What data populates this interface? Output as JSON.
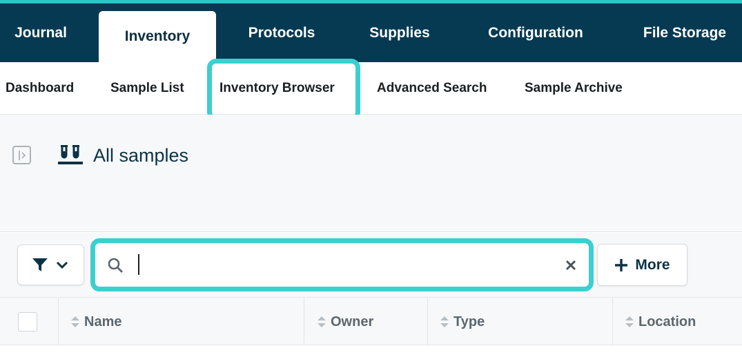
{
  "top_nav": {
    "tabs": [
      {
        "label": "Journal"
      },
      {
        "label": "Inventory",
        "active": true
      },
      {
        "label": "Protocols"
      },
      {
        "label": "Supplies"
      },
      {
        "label": "Configuration"
      },
      {
        "label": "File Storage"
      }
    ]
  },
  "sub_nav": {
    "items": [
      {
        "label": "Dashboard"
      },
      {
        "label": "Sample List"
      },
      {
        "label": "Inventory Browser",
        "highlighted": true
      },
      {
        "label": "Advanced Search"
      },
      {
        "label": "Sample Archive"
      }
    ]
  },
  "page": {
    "title": "All samples"
  },
  "toolbar": {
    "search_value": "",
    "more_label": "More"
  },
  "table": {
    "columns": [
      {
        "label": "Name"
      },
      {
        "label": "Owner"
      },
      {
        "label": "Type"
      },
      {
        "label": "Location"
      }
    ]
  },
  "icons": {
    "sidebar_toggle": "sidebar-expand-icon",
    "page": "test-tubes-icon",
    "filter": "filter-funnel-icon",
    "dropdown": "chevron-down-icon",
    "search": "search-icon",
    "clear": "close-icon",
    "add": "plus-icon",
    "sort": "sort-icon"
  },
  "colors": {
    "nav_background": "#063a52",
    "accent_bar": "#2ec4c6",
    "highlight": "#3ccfd0",
    "title_text": "#0b3347"
  }
}
